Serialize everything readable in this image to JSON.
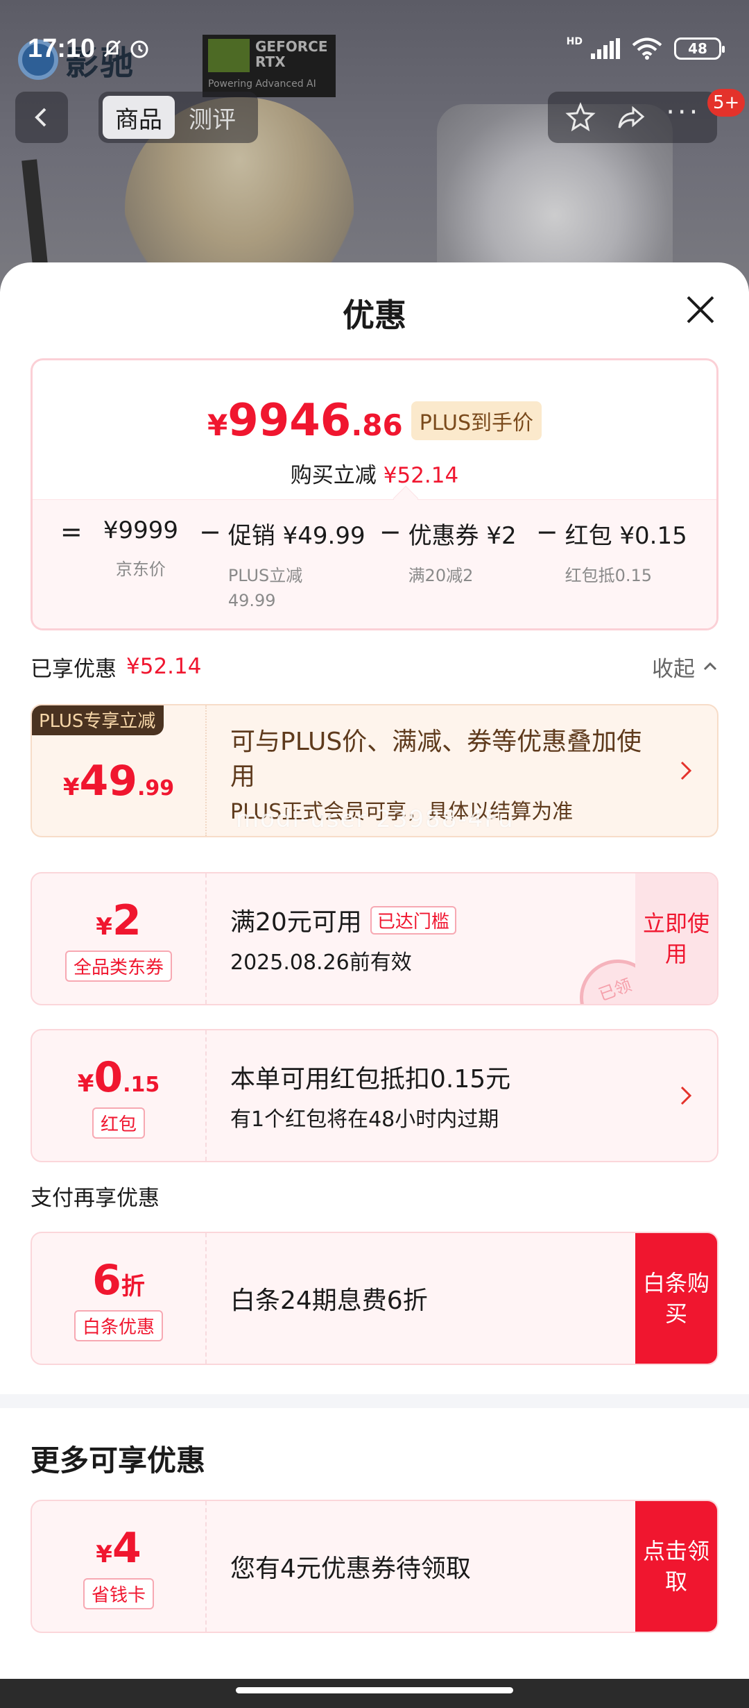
{
  "status_bar": {
    "time": "17:10",
    "network": "HD",
    "battery": "48"
  },
  "product_header": {
    "brand_text": "影驰",
    "rtx_badge": {
      "line1": "GEFORCE",
      "line2": "RTX",
      "line3": "Powering Advanced AI",
      "nvidia": "NVIDIA"
    },
    "tabs": [
      {
        "label": "商品",
        "active": true
      },
      {
        "label": "测评",
        "active": false
      }
    ],
    "message_badge": "5+"
  },
  "sheet": {
    "title": "优惠",
    "price_summary": {
      "currency": "¥",
      "final_price_int": "9946",
      "final_price_dec": ".86",
      "plus_tag": "PLUS到手价",
      "reduce_label": "购买立减",
      "reduce_amount": "¥52.14",
      "breakdown": [
        {
          "op": "=",
          "value": "¥9999",
          "sub": "京东价"
        },
        {
          "op": "−",
          "value": "促销 ¥49.99",
          "sub": "PLUS立减\n49.99"
        },
        {
          "op": "−",
          "value": "优惠券 ¥2",
          "sub": "满20减2"
        },
        {
          "op": "−",
          "value": "红包 ¥0.15",
          "sub": "红包抵0.15"
        }
      ]
    },
    "enjoyed": {
      "label": "已享优惠",
      "amount": "¥52.14",
      "collapse": "收起"
    },
    "offers": {
      "plus": {
        "ribbon": "PLUS专享立减",
        "currency": "¥",
        "int": "49",
        "dec": ".99",
        "text": "可与PLUS价、满减、券等优惠叠加使用",
        "sub": "PLUS正式会员可享，具体以结算为准"
      },
      "coupon": {
        "currency": "¥",
        "int": "2",
        "tag": "全品类东券",
        "title": "满20元可用",
        "reached": "已达门槛",
        "valid": "2025.08.26前有效",
        "button": "立即使用",
        "stamp": "已领"
      },
      "redpacket": {
        "currency": "¥",
        "int": "0",
        "dec": ".15",
        "tag": "红包",
        "title": "本单可用红包抵扣0.15元",
        "sub": "有1个红包将在48小时内过期"
      }
    },
    "payment_section_label": "支付再享优惠",
    "baitiao": {
      "int": "6",
      "unit": "折",
      "tag": "白条优惠",
      "title": "白条24期息费6折",
      "button": "白条购买"
    },
    "more_title": "更多可享优惠",
    "saving_card": {
      "currency": "¥",
      "int": "4",
      "tag": "省钱卡",
      "title": "您有4元优惠券待领取",
      "button": "点击领取"
    },
    "watermark": "modi-user 23988-4Fu"
  },
  "colors": {
    "accent_red": "#f0162f",
    "plus_brown": "#5e3a1c",
    "pink_bg": "#fff4f5"
  }
}
